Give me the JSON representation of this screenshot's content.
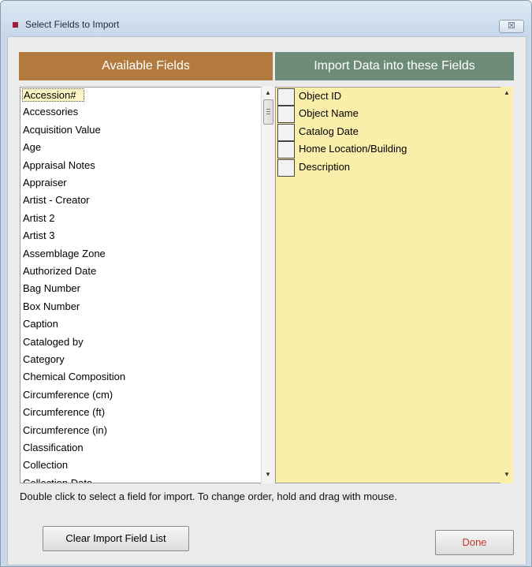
{
  "window": {
    "title": "Select Fields to Import",
    "close_label": "☒"
  },
  "available": {
    "header": "Available Fields",
    "items": [
      "Accession#",
      "Accessories",
      "Acquisition Value",
      "Age",
      "Appraisal Notes",
      "Appraiser",
      "Artist - Creator",
      "Artist 2",
      "Artist 3",
      "Assemblage Zone",
      "Authorized Date",
      "Bag Number",
      "Box Number",
      "Caption",
      "Cataloged by",
      "Category",
      "Chemical Composition",
      "Circumference (cm)",
      "Circumference (ft)",
      "Circumference (in)",
      "Classification",
      "Collection",
      "Collection Date"
    ],
    "selected_index": 0
  },
  "import": {
    "header": "Import Data into these Fields",
    "items": [
      "Object ID",
      "Object Name",
      "Catalog Date",
      "Home Location/Building",
      "Description"
    ]
  },
  "hint": "Double click to select a field for import.  To change order, hold and drag with mouse.",
  "buttons": {
    "clear": "Clear Import Field List",
    "done": "Done"
  },
  "colors": {
    "available_header": "#b37a3e",
    "import_header": "#6e8b78",
    "import_list_bg": "#faeeab",
    "done_text": "#c0392b"
  }
}
